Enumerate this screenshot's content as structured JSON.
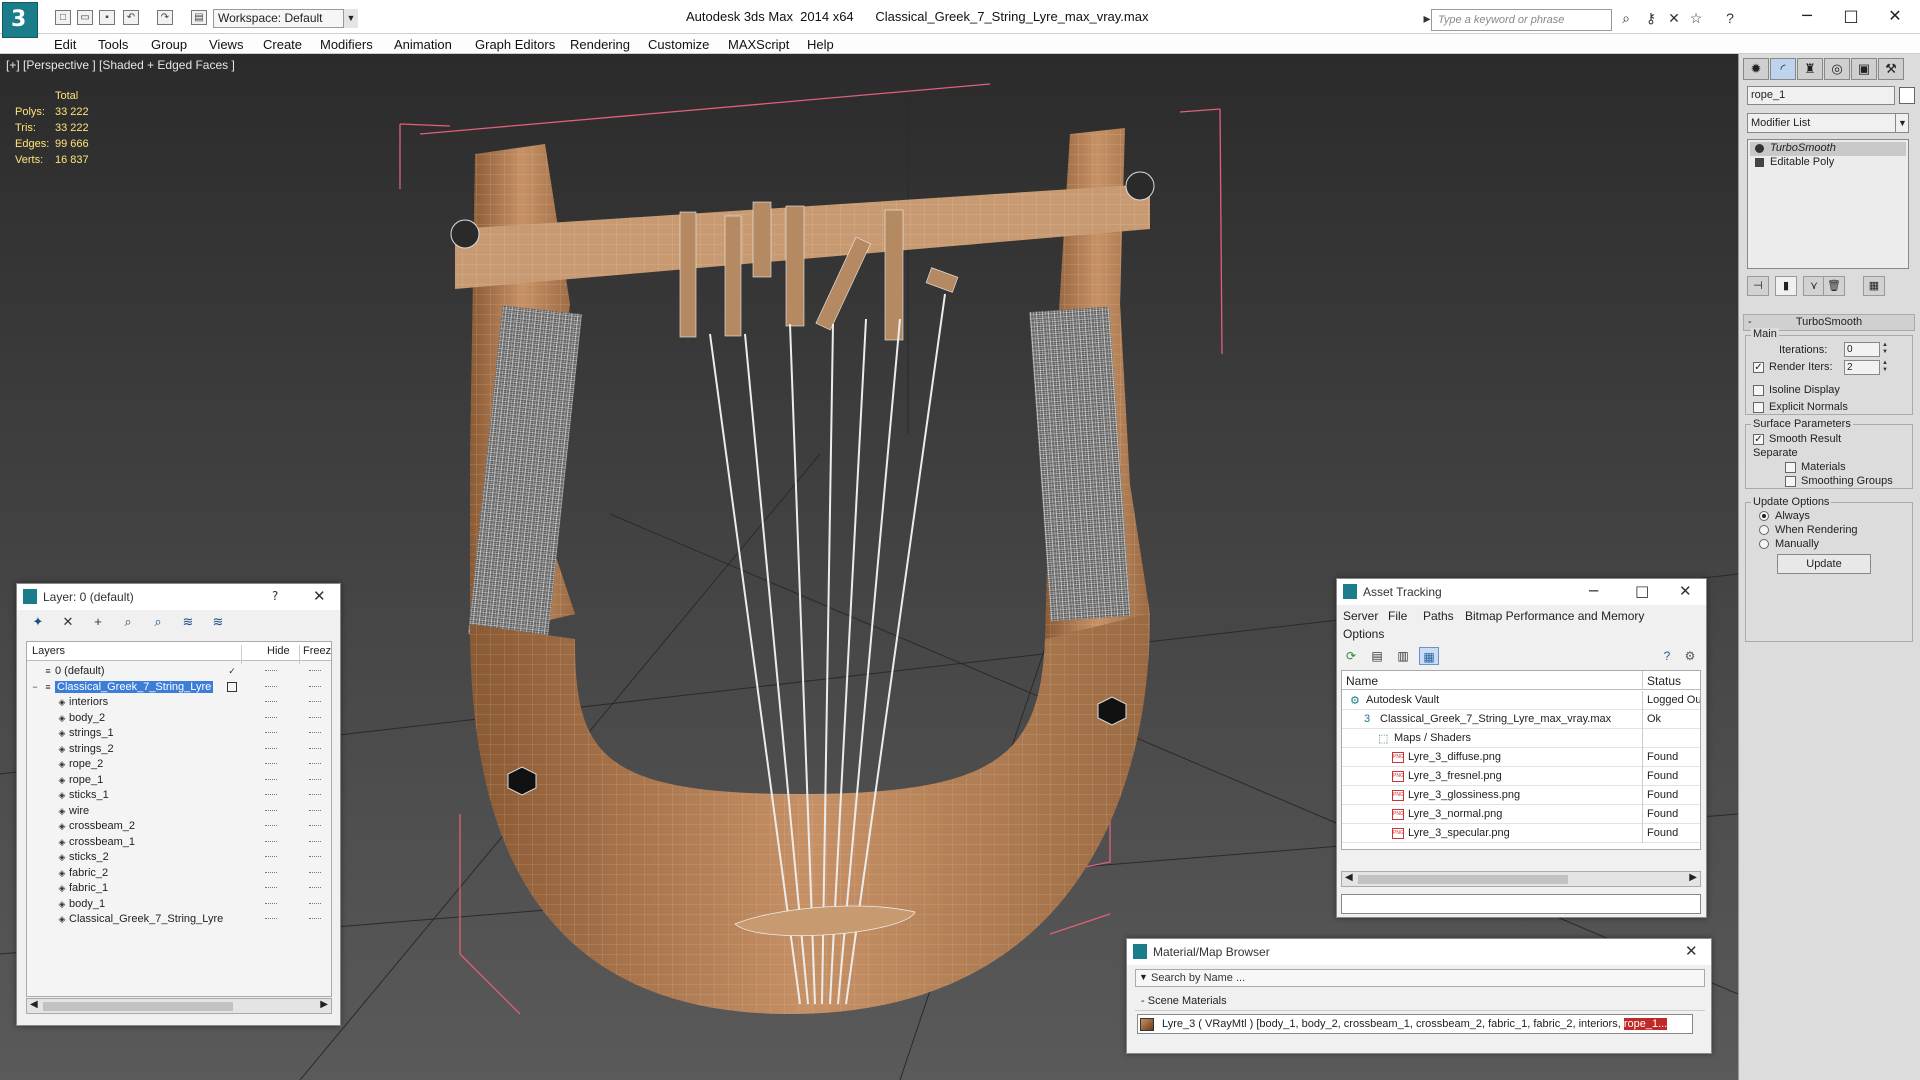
{
  "app": {
    "title": "Autodesk 3ds Max  2014 x64",
    "file": "Classical_Greek_7_String_Lyre_max_vray.max",
    "logo_letter": "3",
    "workspace": "Workspace: Default",
    "search_placeholder": "Type a keyword or phrase"
  },
  "menu": [
    "Edit",
    "Tools",
    "Group",
    "Views",
    "Create",
    "Modifiers",
    "Animation",
    "Graph Editors",
    "Rendering",
    "Customize",
    "MAXScript",
    "Help"
  ],
  "viewport": {
    "label": "[+] [Perspective ] [Shaded + Edged Faces ]",
    "stats": {
      "header": "Total",
      "rows": [
        {
          "label": "Polys:",
          "value": "33 222"
        },
        {
          "label": "Tris:",
          "value": "33 222"
        },
        {
          "label": "Edges:",
          "value": "99 666"
        },
        {
          "label": "Verts:",
          "value": "16 837"
        }
      ]
    }
  },
  "command_panel": {
    "object_name": "rope_1",
    "modifier_list": "Modifier List",
    "stack": [
      "TurboSmooth",
      "Editable Poly"
    ],
    "rollout_title": "TurboSmooth",
    "main_label": "Main",
    "iterations_label": "Iterations:",
    "iterations_value": "0",
    "render_iters_label": "Render Iters:",
    "render_iters_value": "2",
    "render_iters_checked": true,
    "isoline_label": "Isoline Display",
    "explicit_normals_label": "Explicit Normals",
    "surface_params_label": "Surface Parameters",
    "smooth_result_label": "Smooth Result",
    "smooth_result_checked": true,
    "separate_label": "Separate",
    "materials_label": "Materials",
    "smoothing_groups_label": "Smoothing Groups",
    "update_options_label": "Update Options",
    "update_always": "Always",
    "update_when_rendering": "When Rendering",
    "update_manually": "Manually",
    "update_button": "Update"
  },
  "layer_window": {
    "title": "Layer: 0 (default)",
    "help": "?",
    "columns": {
      "layers": "Layers",
      "hide": "Hide",
      "freeze": "Freez"
    },
    "rows": [
      {
        "name": "0 (default)",
        "level": 0,
        "kind": "layer",
        "active": true
      },
      {
        "name": "Classical_Greek_7_String_Lyre",
        "level": 0,
        "kind": "layer",
        "selected": true
      },
      {
        "name": "interiors",
        "level": 1,
        "kind": "object"
      },
      {
        "name": "body_2",
        "level": 1,
        "kind": "object"
      },
      {
        "name": "strings_1",
        "level": 1,
        "kind": "object"
      },
      {
        "name": "strings_2",
        "level": 1,
        "kind": "object"
      },
      {
        "name": "rope_2",
        "level": 1,
        "kind": "object"
      },
      {
        "name": "rope_1",
        "level": 1,
        "kind": "object"
      },
      {
        "name": "sticks_1",
        "level": 1,
        "kind": "object"
      },
      {
        "name": "wire",
        "level": 1,
        "kind": "object"
      },
      {
        "name": "crossbeam_2",
        "level": 1,
        "kind": "object"
      },
      {
        "name": "crossbeam_1",
        "level": 1,
        "kind": "object"
      },
      {
        "name": "sticks_2",
        "level": 1,
        "kind": "object"
      },
      {
        "name": "fabric_2",
        "level": 1,
        "kind": "object"
      },
      {
        "name": "fabric_1",
        "level": 1,
        "kind": "object"
      },
      {
        "name": "body_1",
        "level": 1,
        "kind": "object"
      },
      {
        "name": "Classical_Greek_7_String_Lyre",
        "level": 1,
        "kind": "object"
      }
    ]
  },
  "asset_window": {
    "title": "Asset Tracking",
    "menu": [
      "Server",
      "File",
      "Paths",
      "Bitmap Performance and Memory",
      "Options"
    ],
    "columns": {
      "name": "Name",
      "status": "Status"
    },
    "rows": [
      {
        "name": "Autodesk Vault",
        "status": "Logged Ou",
        "level": 0,
        "icon": "vault"
      },
      {
        "name": "Classical_Greek_7_String_Lyre_max_vray.max",
        "status": "Ok",
        "level": 1,
        "icon": "max"
      },
      {
        "name": "Maps / Shaders",
        "status": "",
        "level": 2,
        "icon": "maps"
      },
      {
        "name": "Lyre_3_diffuse.png",
        "status": "Found",
        "level": 3,
        "icon": "png"
      },
      {
        "name": "Lyre_3_fresnel.png",
        "status": "Found",
        "level": 3,
        "icon": "png"
      },
      {
        "name": "Lyre_3_glossiness.png",
        "status": "Found",
        "level": 3,
        "icon": "png"
      },
      {
        "name": "Lyre_3_normal.png",
        "status": "Found",
        "level": 3,
        "icon": "png"
      },
      {
        "name": "Lyre_3_specular.png",
        "status": "Found",
        "level": 3,
        "icon": "png"
      }
    ]
  },
  "material_window": {
    "title": "Material/Map Browser",
    "search_placeholder": "Search by Name ...",
    "section": "Scene Materials",
    "item_prefix": "Lyre_3  ( VRayMtl ) [body_1, body_2, crossbeam_1, crossbeam_2, fabric_1, fabric_2, interiors, ",
    "item_highlight": "rope_1..."
  },
  "colors": {
    "selection": "#3c7dd9",
    "stats_text": "#ffe47a",
    "wood": "#b98357",
    "bbox": "#e0607a"
  }
}
